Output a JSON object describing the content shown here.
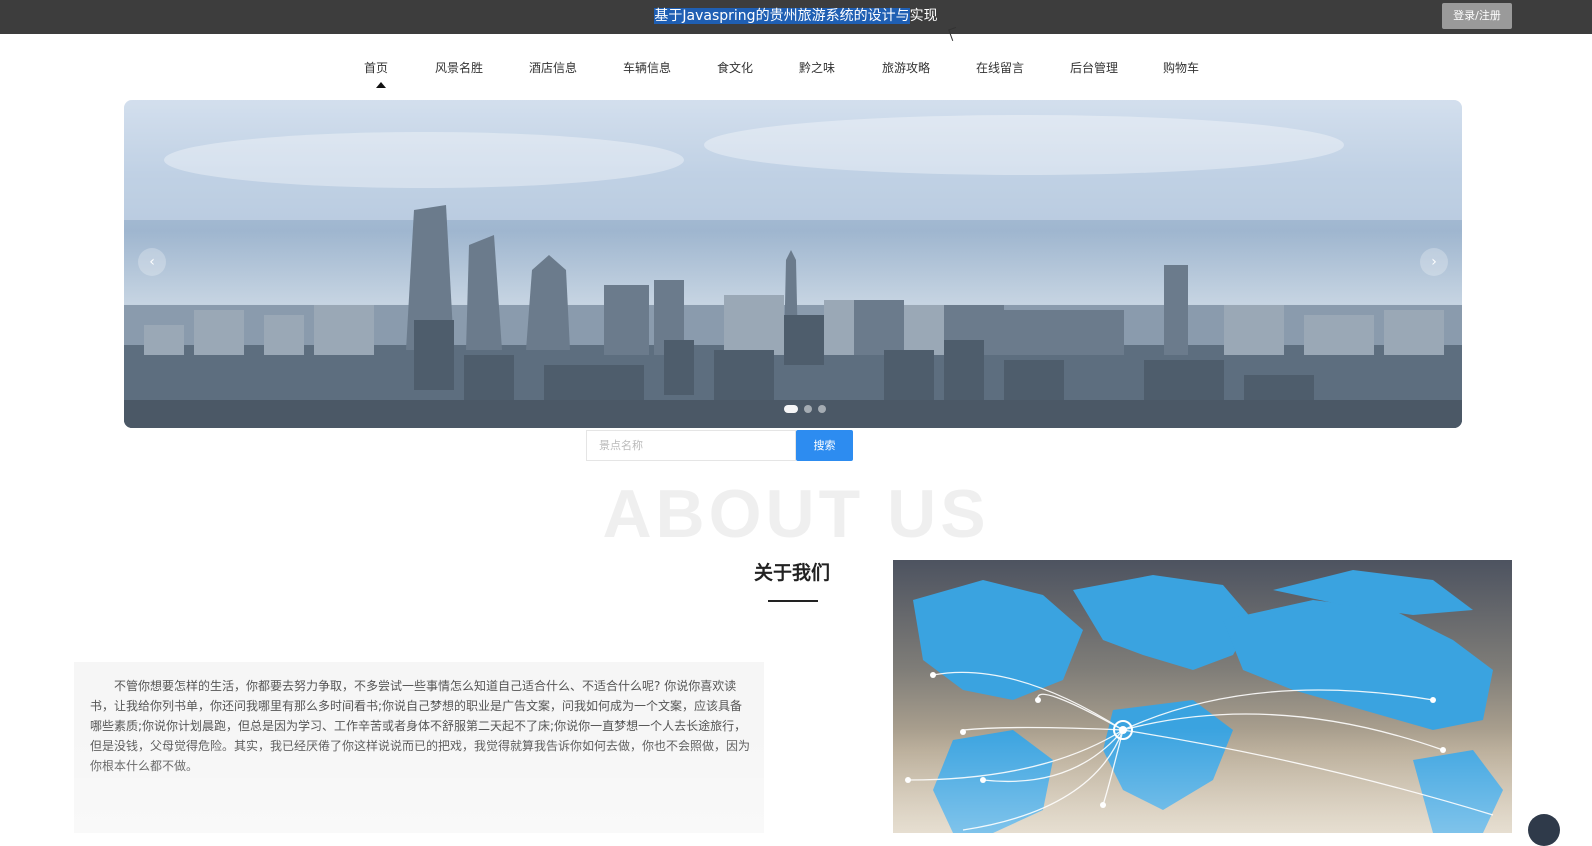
{
  "header": {
    "title_highlighted": "基于Javaspring的贵州旅游系统的设计与",
    "title_rest": "实现",
    "login_label": "登录/注册"
  },
  "nav": {
    "items": [
      {
        "label": "首页",
        "active": true
      },
      {
        "label": "风景名胜"
      },
      {
        "label": "酒店信息"
      },
      {
        "label": "车辆信息"
      },
      {
        "label": "食文化"
      },
      {
        "label": "黔之味"
      },
      {
        "label": "旅游攻略"
      },
      {
        "label": "在线留言"
      },
      {
        "label": "后台管理"
      },
      {
        "label": "购物车"
      }
    ]
  },
  "carousel": {
    "prev_icon": "‹",
    "next_icon": "›",
    "slide_count": 3,
    "active_index": 0
  },
  "search": {
    "placeholder": "景点名称",
    "button_label": "搜索"
  },
  "about": {
    "background_text": "ABOUT US",
    "title": "关于我们",
    "body": "不管你想要怎样的生活，你都要去努力争取，不多尝试一些事情怎么知道自己适合什么、不适合什么呢? 你说你喜欢读书，让我给你列书单，你还问我哪里有那么多时间看书;你说自己梦想的职业是广告文案，问我如何成为一个文案，应该具备哪些素质;你说你计划晨跑，但总是因为学习、工作辛苦或者身体不舒服第二天起不了床;你说你一直梦想一个人去长途旅行，但是没钱，父母觉得危险。其实，我已经厌倦了你这样说说而已的把戏，我觉得就算我告诉你如何去做，你也不会照做，因为你根本什么都不做。"
  },
  "colors": {
    "topbar": "#3d3d3d",
    "accent_blue": "#2d8cf0",
    "title_highlight": "#1f5fb3"
  }
}
